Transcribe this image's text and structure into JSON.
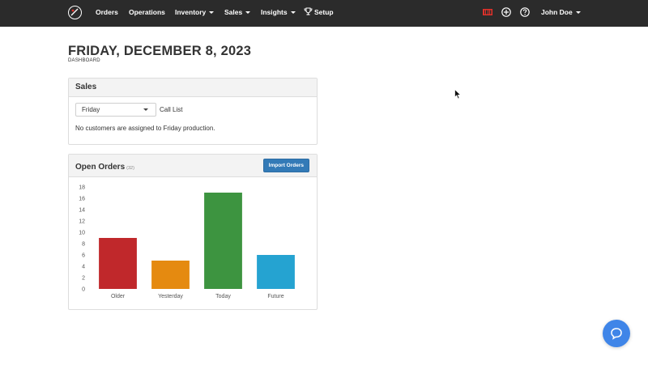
{
  "nav": {
    "items": [
      {
        "label": "Orders",
        "has_caret": false
      },
      {
        "label": "Operations",
        "has_caret": false
      },
      {
        "label": "Inventory",
        "has_caret": true
      },
      {
        "label": "Sales",
        "has_caret": true
      },
      {
        "label": "Insights",
        "has_caret": true
      },
      {
        "label": "Setup",
        "has_caret": false
      }
    ],
    "user_name": "John Doe",
    "icons": [
      "logo-icon",
      "trophy-icon",
      "barcode-scanner-icon",
      "add-circle-icon",
      "help-circle-icon",
      "chevron-down-icon"
    ],
    "accent_icon_color": "#e0312a"
  },
  "page": {
    "title": "FRIDAY, DECEMBER 8, 2023",
    "subtitle": "DASHBOARD"
  },
  "sales_panel": {
    "title": "Sales",
    "day_select_value": "Friday",
    "call_list_label": "Call List",
    "info_text": "No customers are assigned to Friday production."
  },
  "orders_panel": {
    "title": "Open Orders",
    "count_label": "(32)",
    "import_button_label": "Import Orders"
  },
  "chart_data": {
    "type": "bar",
    "categories": [
      "Older",
      "Yesterday",
      "Today",
      "Future"
    ],
    "values": [
      9,
      5,
      17,
      6
    ],
    "colors": [
      "#c0282b",
      "#e58a10",
      "#3d9440",
      "#25a3d1"
    ],
    "ylim": [
      0,
      18
    ],
    "yticks": [
      0,
      2,
      4,
      6,
      8,
      10,
      12,
      14,
      16,
      18
    ],
    "title": "",
    "xlabel": "",
    "ylabel": "",
    "grid": false,
    "legend": "none"
  },
  "colors": {
    "navbar_bg": "#2b2b2b",
    "primary_button": "#337ab7",
    "help_bubble": "#3f85e8"
  }
}
